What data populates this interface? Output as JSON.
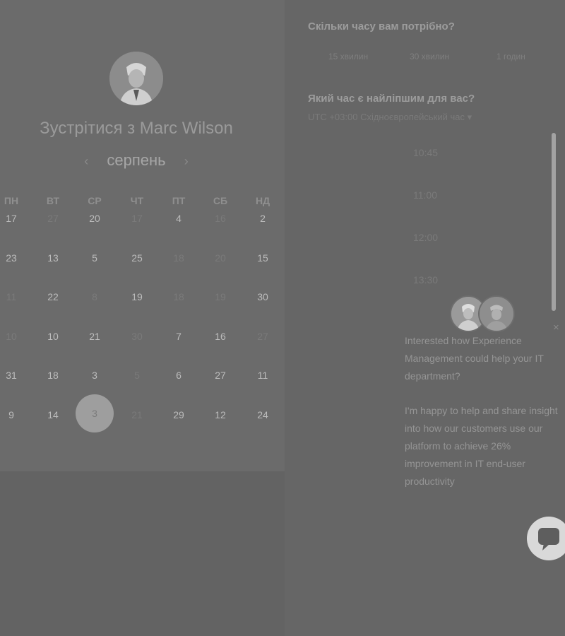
{
  "meeting": {
    "title": "Зустрітися з Marc Wilson"
  },
  "calendar": {
    "month": "серпень",
    "prev_icon": "‹",
    "next_icon": "›",
    "weekdays": [
      "ПН",
      "ВТ",
      "СР",
      "ЧТ",
      "ПТ",
      "СБ",
      "НД"
    ],
    "rows": [
      [
        "17",
        "27",
        "20",
        "17",
        "4",
        "16",
        "2"
      ],
      [
        "23",
        "13",
        "5",
        "25",
        "18",
        "20",
        "15"
      ],
      [
        "11",
        "22",
        "8",
        "19",
        "18",
        "19",
        "30"
      ],
      [
        "10",
        "10",
        "21",
        "30",
        "7",
        "16",
        "27"
      ],
      [
        "31",
        "18",
        "3",
        "5",
        "6",
        "27",
        "11"
      ],
      [
        "9",
        "14",
        "3",
        "21",
        "29",
        "12",
        "24"
      ]
    ],
    "selected_day": "3"
  },
  "duration": {
    "heading": "Скільки часу вам потрібно?",
    "options": [
      "15 хвилин",
      "30 хвилин",
      "1 годин"
    ]
  },
  "time": {
    "heading": "Який час є найліпшим для вас?",
    "timezone": "UTC +03:00 Східноєвропейський час",
    "timezone_arrow": "▾",
    "slots": [
      "10:45",
      "11:00",
      "12:00",
      "13:30"
    ]
  },
  "chat": {
    "close_icon": "×",
    "message1": "Interested how Experience Management could help your IT department?",
    "message2": "I'm happy to help and share insight into how our customers use our platform to achieve 26% improvement in IT end-user productivity"
  },
  "colors": {
    "overlay": "#636363",
    "left_panel": "#6b6b6b",
    "selected_day": "#9e9e9e",
    "launcher": "#d9d9d9"
  },
  "icons": {
    "prev_month": "chevron-left-icon",
    "next_month": "chevron-right-icon",
    "chat_close": "close-icon",
    "launcher": "chat-bubble-icon"
  }
}
